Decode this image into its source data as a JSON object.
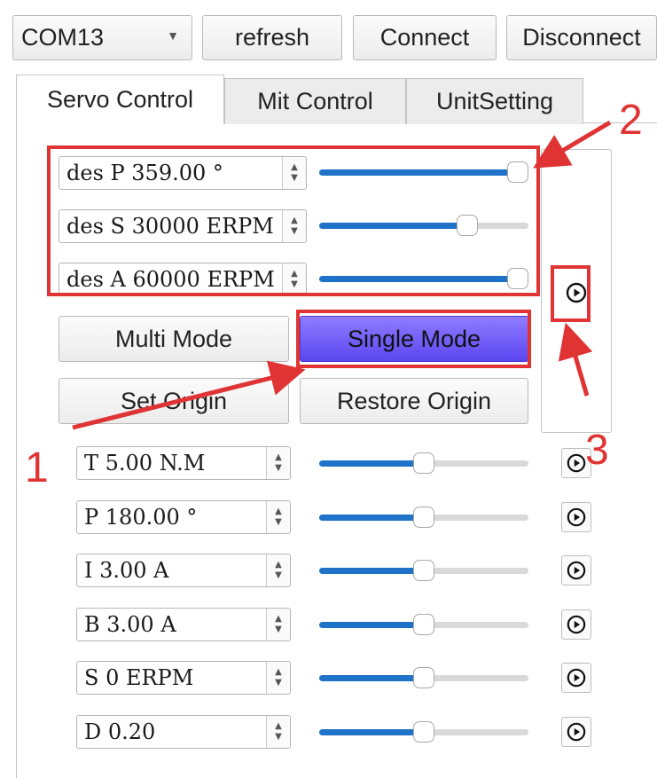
{
  "toolbar": {
    "port_value": "COM13",
    "refresh_label": "refresh",
    "connect_label": "Connect",
    "disconnect_label": "Disconnect"
  },
  "tabs": [
    {
      "label": "Servo Control",
      "active": true
    },
    {
      "label": "Mit Control",
      "active": false
    },
    {
      "label": "UnitSetting",
      "active": false
    }
  ],
  "servo": {
    "des_rows": [
      {
        "value": "des P 359.00 °",
        "level": 1.0
      },
      {
        "value": "des S 30000 ERPM",
        "level": 0.73
      },
      {
        "value": "des A 60000 ERPM",
        "level": 1.0
      }
    ],
    "multi_mode_label": "Multi Mode",
    "single_mode_label": "Single Mode",
    "set_origin_label": "Set Origin",
    "restore_origin_label": "Restore Origin",
    "param_rows": [
      {
        "value": "T 5.00 N.M",
        "level": 0.5
      },
      {
        "value": "P 180.00 °",
        "level": 0.5
      },
      {
        "value": "I 3.00 A",
        "level": 0.5
      },
      {
        "value": "B 3.00 A",
        "level": 0.5
      },
      {
        "value": "S 0 ERPM",
        "level": 0.5
      },
      {
        "value": "D 0.20",
        "level": 0.5
      }
    ]
  },
  "annotations": [
    "1",
    "2",
    "3"
  ],
  "colors": {
    "accent": "#1e73c8",
    "annotation": "#e03434",
    "selected_button": "#6a55f5"
  },
  "icons": [
    "chevron-down-icon",
    "spin-arrows-icon",
    "play-circle-icon"
  ]
}
